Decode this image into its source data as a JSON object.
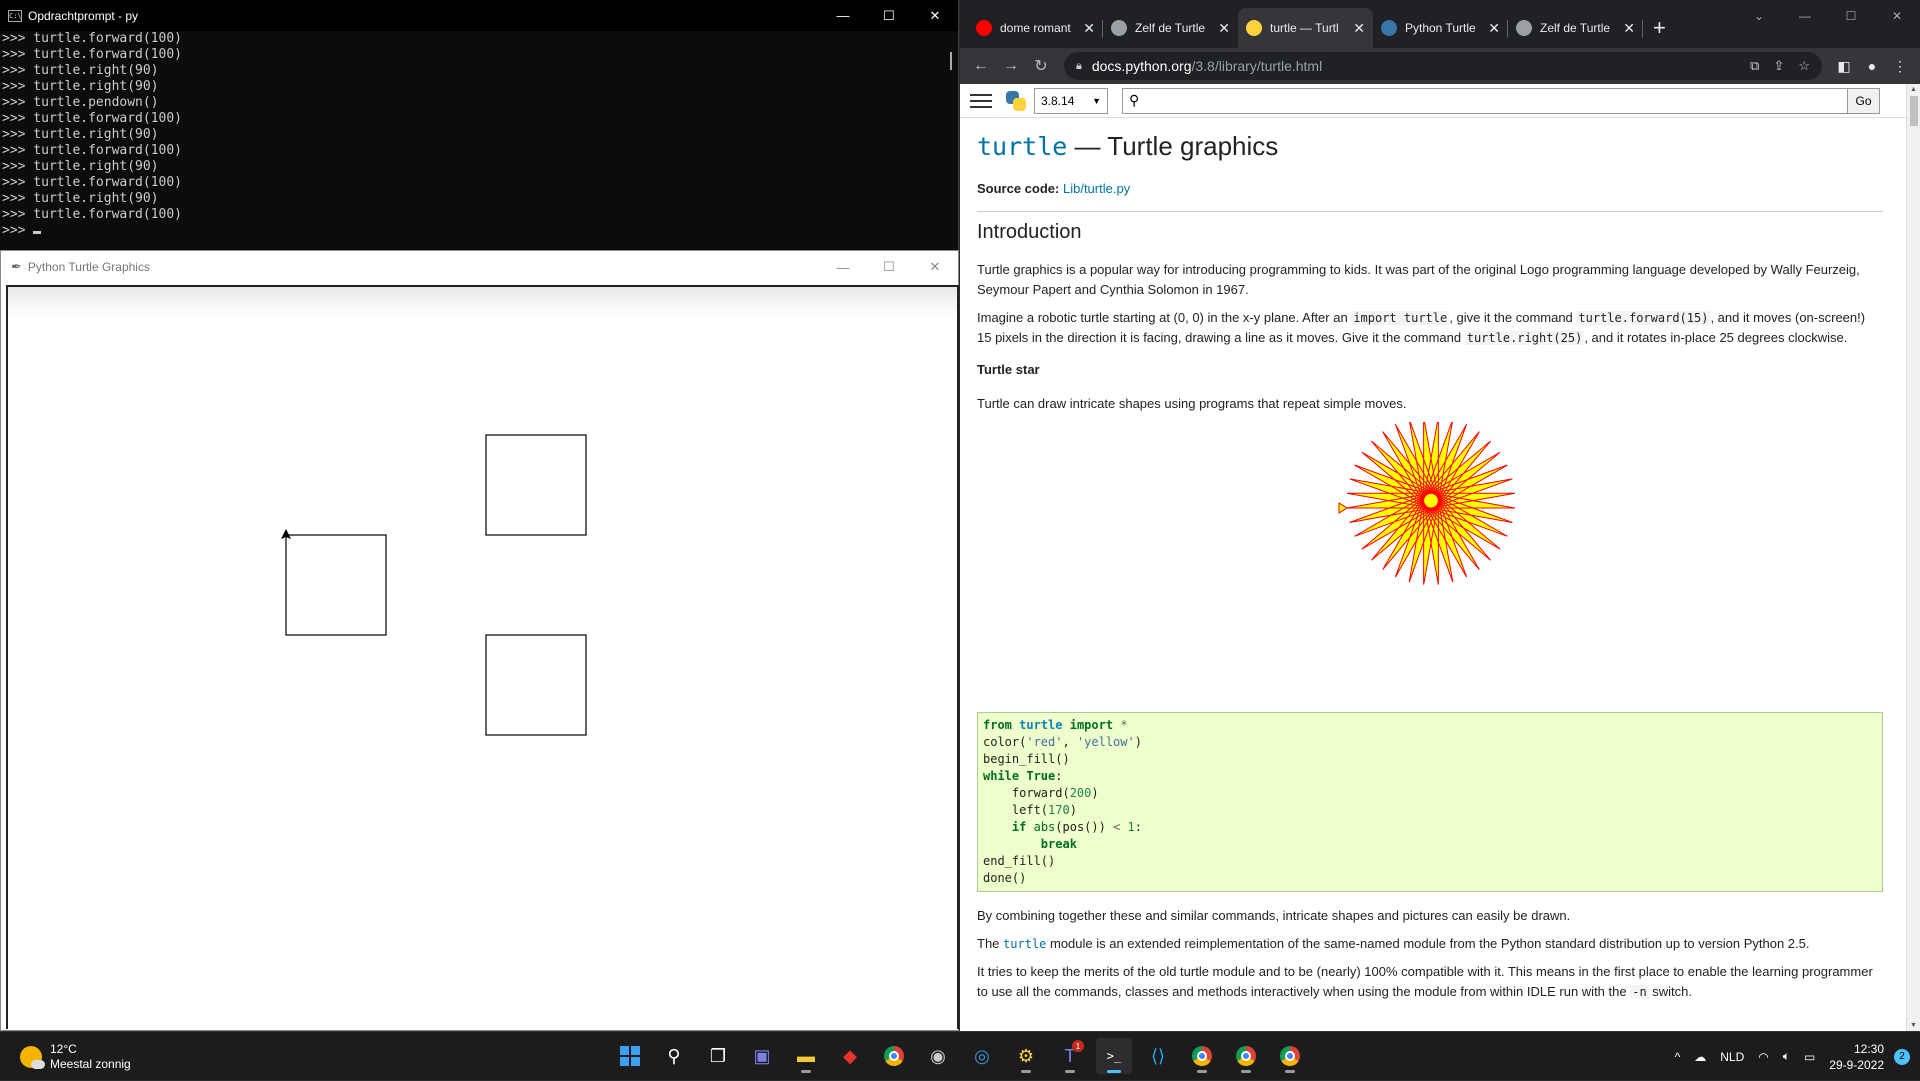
{
  "cmd": {
    "title": "Opdrachtprompt - py",
    "icon": "cmd-icon",
    "lines": [
      ">>> turtle.forward(100)",
      ">>> turtle.forward(100)",
      ">>> turtle.right(90)",
      ">>> turtle.right(90)",
      ">>> turtle.pendown()",
      ">>> turtle.forward(100)",
      ">>> turtle.right(90)",
      ">>> turtle.forward(100)",
      ">>> turtle.right(90)",
      ">>> turtle.forward(100)",
      ">>> turtle.right(90)",
      ">>> turtle.forward(100)"
    ],
    "prompt": ">>> "
  },
  "turtle_window": {
    "title": "Python Turtle Graphics",
    "squares": [
      {
        "id": "square-left"
      },
      {
        "id": "square-top-right"
      },
      {
        "id": "square-bottom-right"
      }
    ]
  },
  "browser": {
    "tabs": [
      {
        "label": "dome romant",
        "icon": "youtube-icon",
        "active": false
      },
      {
        "label": "Zelf de Turtle",
        "icon": "globe-icon",
        "active": false
      },
      {
        "label": "turtle — Turtl",
        "icon": "python-icon",
        "active": true
      },
      {
        "label": "Python Turtle",
        "icon": "python-doc-icon",
        "active": false
      },
      {
        "label": "Zelf de Turtle",
        "icon": "globe-icon",
        "active": false
      }
    ],
    "url_host": "docs.python.org",
    "url_path": "/3.8/library/turtle.html"
  },
  "doc": {
    "version": "3.8.14",
    "search_placeholder": "",
    "go_label": "Go",
    "title_code": "turtle",
    "title_rest": " — Turtle graphics",
    "source_label": "Source code:",
    "source_link": "Lib/turtle.py",
    "intro_heading": "Introduction",
    "intro_p1": "Turtle graphics is a popular way for introducing programming to kids. It was part of the original Logo programming language developed by Wally Feurzeig, Seymour Papert and Cynthia Solomon in 1967.",
    "intro_p2_a": "Imagine a robotic turtle starting at (0, 0) in the x-y plane. After an ",
    "intro_p2_code1": "import turtle",
    "intro_p2_b": ", give it the command ",
    "intro_p2_code2": "turtle.forward(15)",
    "intro_p2_c": ", and it moves (on-screen!) 15 pixels in the direction it is facing, drawing a line as it moves. Give it the command ",
    "intro_p2_code3": "turtle.right(25)",
    "intro_p2_d": ", and it rotates in-place 25 degrees clockwise.",
    "star_heading": "Turtle star",
    "star_p": "Turtle can draw intricate shapes using programs that repeat simple moves.",
    "after_code_p1": "By combining together these and similar commands, intricate shapes and pictures can easily be drawn.",
    "p_module_a": "The ",
    "p_module_code": "turtle",
    "p_module_b": " module is an extended reimplementation of the same-named module from the Python standard distribution up to version Python 2.5.",
    "p_merits_a": "It tries to keep the merits of the old turtle module and to be (nearly) 100% compatible with it. This means in the first place to enable the learning programmer to use all the commands, classes and methods interactively when using the module from within IDLE run with the ",
    "p_merits_code": "-n",
    "p_merits_b": " switch.",
    "star_colors": {
      "line": "#ff0000",
      "fill": "#ffff00"
    }
  },
  "taskbar": {
    "temp": "12°C",
    "weather": "Meestal zonnig",
    "lang": "NLD",
    "time": "12:30",
    "date": "29-9-2022",
    "notifications": "2",
    "teams_badge": "1"
  }
}
